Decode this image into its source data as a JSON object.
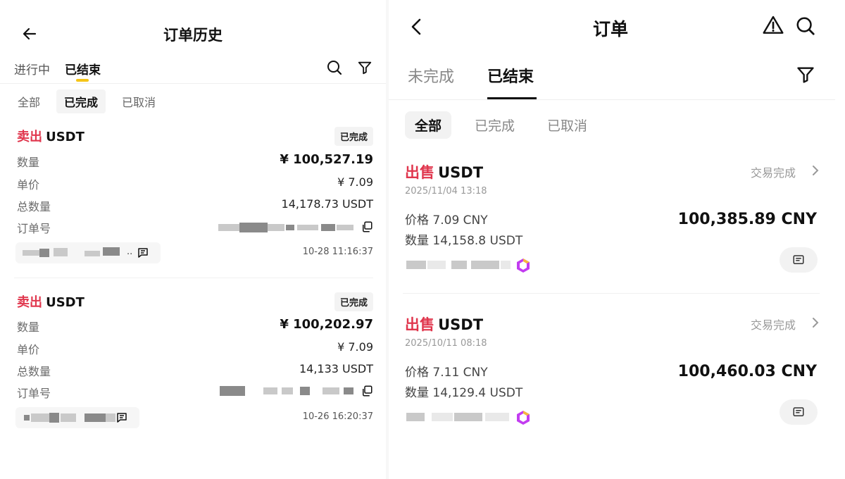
{
  "left": {
    "title": "订单历史",
    "tabs": [
      {
        "label": "进行中",
        "active": false
      },
      {
        "label": "已结束",
        "active": true
      }
    ],
    "filters": [
      {
        "label": "全部",
        "active": false
      },
      {
        "label": "已完成",
        "active": true
      },
      {
        "label": "已取消",
        "active": false
      }
    ],
    "accent_color": "#f5c518",
    "sell_color": "#e0364d",
    "icons": [
      "back-arrow-icon",
      "search-icon",
      "filter-icon",
      "copy-icon",
      "chat-icon"
    ],
    "orders": [
      {
        "side": "卖出",
        "coin": "USDT",
        "status": "已完成",
        "rows": [
          {
            "label": "数量",
            "value": "¥ 100,527.19"
          },
          {
            "label": "单价",
            "value": "¥ 7.09"
          },
          {
            "label": "总数量",
            "value": "14,178.73 USDT"
          },
          {
            "label": "订单号",
            "value": ""
          }
        ],
        "counterparty_suffix": "..",
        "time": "10-28 11:16:37"
      },
      {
        "side": "卖出",
        "coin": "USDT",
        "status": "已完成",
        "rows": [
          {
            "label": "数量",
            "value": "¥ 100,202.97"
          },
          {
            "label": "单价",
            "value": "¥ 7.09"
          },
          {
            "label": "总数量",
            "value": "14,133 USDT"
          },
          {
            "label": "订单号",
            "value": ""
          }
        ],
        "counterparty_suffix": "",
        "time": "10-26 16:20:37"
      }
    ]
  },
  "right": {
    "title": "订单",
    "tabs": [
      {
        "label": "未完成",
        "active": false
      },
      {
        "label": "已结束",
        "active": true
      }
    ],
    "filters": [
      {
        "label": "全部",
        "active": true
      },
      {
        "label": "已完成",
        "active": false
      },
      {
        "label": "已取消",
        "active": false
      }
    ],
    "icons": [
      "back-chevron-icon",
      "warning-icon",
      "search-icon",
      "filter-icon",
      "chevron-right-icon",
      "chat-icon",
      "merchant-badge-icon"
    ],
    "orders": [
      {
        "side": "出售",
        "coin": "USDT",
        "date": "2025/11/04 13:18",
        "status": "交易完成",
        "price": "价格 7.09 CNY",
        "amount": "数量 14,158.8 USDT",
        "total": "100,385.89 CNY"
      },
      {
        "side": "出售",
        "coin": "USDT",
        "date": "2025/10/11 08:18",
        "status": "交易完成",
        "price": "价格 7.11 CNY",
        "amount": "数量 14,129.4 USDT",
        "total": "100,460.03 CNY"
      }
    ]
  }
}
